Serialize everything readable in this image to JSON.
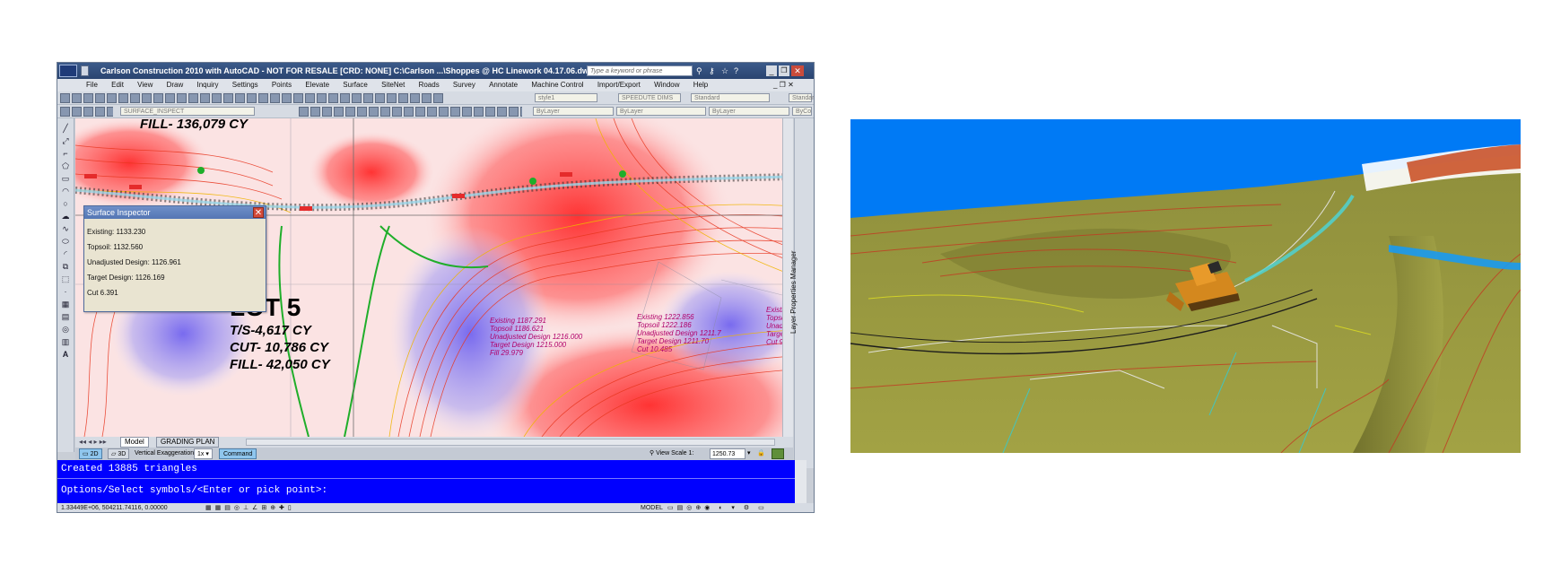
{
  "window": {
    "title": "Carlson Construction 2010 with AutoCAD - NOT FOR RESALE [CRD: NONE]   C:\\Carlson ...\\Shoppes @ HC Linework 04.17.06.dwg",
    "search_placeholder": "Type a keyword or phrase"
  },
  "menu": [
    "File",
    "Edit",
    "View",
    "Draw",
    "Inquiry",
    "Settings",
    "Points",
    "Elevate",
    "Surface",
    "SiteNet",
    "Roads",
    "Survey",
    "Annotate",
    "Machine Control",
    "Import/Export",
    "Window",
    "Help"
  ],
  "toolbar": {
    "text_style": "style1",
    "dim_style": "SPEEDUTE DIMS",
    "table_style": "Standard",
    "ml_style": "Standard",
    "layer": "SURFACE_INSPECT",
    "color": "ByLayer",
    "linetype": "ByLayer",
    "lineweight": "ByLayer",
    "plotstyle": "ByCo"
  },
  "inspector": {
    "title": "Surface Inspector",
    "close": "✕",
    "rows": [
      "Existing: 1133.230",
      "Topsoil: 1132.560",
      "Unadjusted Design: 1126.961",
      "Target Design: 1126.169",
      "Cut 6.391"
    ]
  },
  "map": {
    "fill_top": "FILL- 136,079 CY",
    "lot_title": "LOT 5",
    "lot_lines": [
      "T/S-4,617 CY",
      "CUT- 10,786 CY",
      "FILL- 42,050 CY"
    ],
    "label_a": [
      "Existing 1187.291",
      "Topsoil 1186.621",
      "Unadjusted Design 1216.000",
      "Target Design 1215.000",
      "Fill 29.979"
    ],
    "label_b": [
      "Existing 1222.856",
      "Topsoil 1222.186",
      "Unadjusted Design 1211.7",
      "Target Design 1211.70",
      "Cut 10.485"
    ],
    "label_c": [
      "Existi",
      "Topsc",
      "Unadj",
      "Targe",
      "Cut 9"
    ]
  },
  "tabs": [
    "Model",
    "GRADING PLAN"
  ],
  "status": {
    "mode_2d": "2D",
    "mode_3d": "3D",
    "vert_exag_label": "Vertical Exaggeration",
    "vert_exag_value": "1x",
    "command": "Command",
    "view_scale_label": "View Scale",
    "view_scale_value": "1250.73",
    "view_scale_prefix": "1:"
  },
  "command_lines": [
    "Created 13885 triangles",
    "Options/Select symbols/<Enter or pick point>:"
  ],
  "palette_label": "Layer Properties Manager",
  "bottom": {
    "coords": "1.33449E+06, 504211.74116, 0.00000",
    "model": "MODEL"
  },
  "colors": {
    "command_bg": "#0000ff",
    "sky": "#007af5",
    "terrain": "#9a9a3f",
    "title_bar": "#3b5a8a"
  }
}
